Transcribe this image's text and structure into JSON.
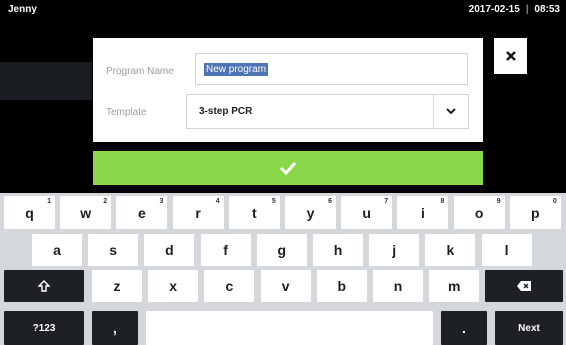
{
  "status_bar": {
    "user": "Jenny",
    "date": "2017-02-15",
    "separator": "|",
    "time": "08:53"
  },
  "dialog": {
    "program_name_label": "Program Name",
    "program_name_value": "New program",
    "template_label": "Template",
    "template_value": "3-step PCR",
    "template_dropdown_icon": "chevron-down-icon",
    "close_icon": "close-icon",
    "confirm_icon": "checkmark-icon"
  },
  "keyboard": {
    "row1": [
      {
        "label": "q",
        "hint": "1"
      },
      {
        "label": "w",
        "hint": "2"
      },
      {
        "label": "e",
        "hint": "3"
      },
      {
        "label": "r",
        "hint": "4"
      },
      {
        "label": "t",
        "hint": "5"
      },
      {
        "label": "y",
        "hint": "6"
      },
      {
        "label": "u",
        "hint": "7"
      },
      {
        "label": "i",
        "hint": "8"
      },
      {
        "label": "o",
        "hint": "9"
      },
      {
        "label": "p",
        "hint": "0"
      }
    ],
    "row2": [
      "a",
      "s",
      "d",
      "f",
      "g",
      "h",
      "j",
      "k",
      "l"
    ],
    "row3": [
      "z",
      "x",
      "c",
      "v",
      "b",
      "n",
      "m"
    ],
    "shift_icon": "shift-icon",
    "backspace_icon": "backspace-icon",
    "symbols_label": "?123",
    "comma_label": ",",
    "period_label": ".",
    "next_label": "Next"
  },
  "colors": {
    "background": "#000000",
    "confirm_green": "#8ad84a",
    "selection_blue": "#4d74b5",
    "keyboard_bg": "#d4d8dc",
    "dark_key": "#1e2124"
  }
}
